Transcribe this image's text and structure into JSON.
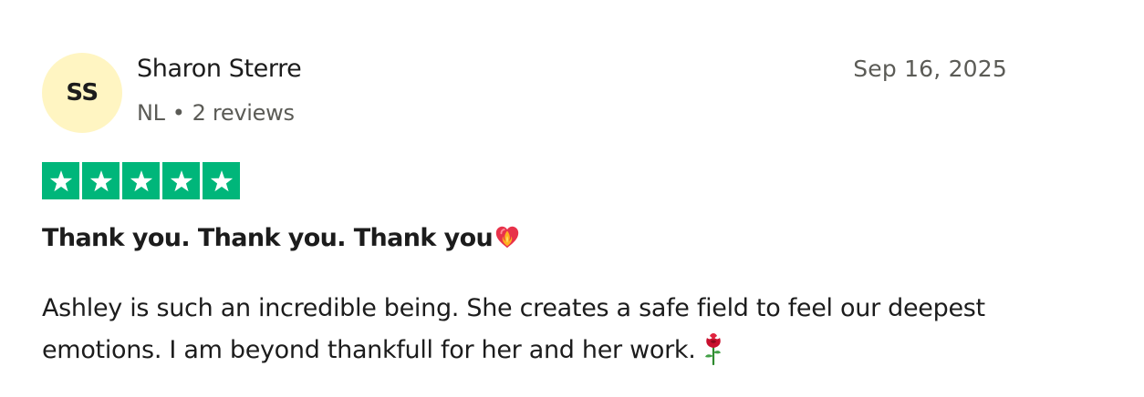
{
  "review": {
    "author": {
      "initials": "SS",
      "name": "Sharon Sterre",
      "country": "NL",
      "separator": "•",
      "review_count": "2 reviews",
      "avatar_color": "#fff5c2"
    },
    "date": "Sep 16, 2025",
    "rating": {
      "value": 5,
      "max": 5,
      "star_color": "#00b67a",
      "star_icon": "white-star-icon"
    },
    "title": "Thank you. Thank you. Thank you",
    "title_emoji": "heart-on-fire-icon",
    "body": "Ashley is such an incredible being. She creates a safe field to feel our deepest emotions. I am beyond thankfull for her and her work.",
    "body_emoji": "rose-icon"
  }
}
